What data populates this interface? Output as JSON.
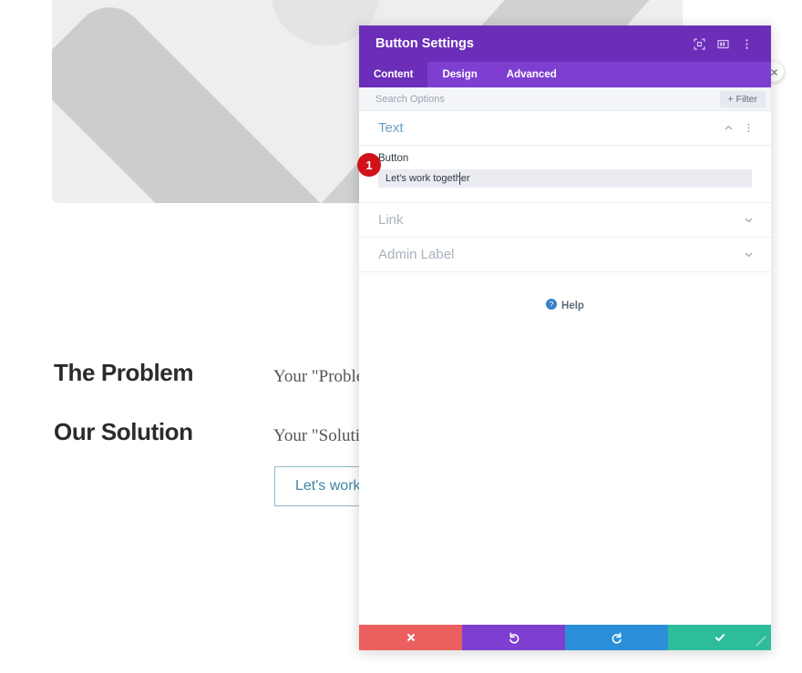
{
  "page": {
    "sections": [
      {
        "heading": "The Problem",
        "body": "Your \"Problem"
      },
      {
        "heading": "Our Solution",
        "body": "Your \"Solutio"
      }
    ],
    "cta_label": "Let's work tog",
    "hero_icon": "image-placeholder-icon"
  },
  "modal": {
    "title": "Button Settings",
    "header_icons": [
      {
        "name": "fullscreen-icon"
      },
      {
        "name": "layout-columns-icon"
      },
      {
        "name": "vertical-dots-icon"
      }
    ],
    "tabs": [
      {
        "label": "Content",
        "active": true
      },
      {
        "label": "Design",
        "active": false
      },
      {
        "label": "Advanced",
        "active": false
      }
    ],
    "search": {
      "placeholder": "Search Options",
      "value": ""
    },
    "filter_label": "+ Filter",
    "groups": [
      {
        "title": "Text",
        "expanded": true,
        "toggle_icon": "chevron-up-icon",
        "menu_icon": "vertical-dots-icon",
        "field_label": "Button",
        "field_value": "Let's work together"
      },
      {
        "title": "Link",
        "expanded": false,
        "toggle_icon": "chevron-down-icon"
      },
      {
        "title": "Admin Label",
        "expanded": false,
        "toggle_icon": "chevron-down-icon"
      }
    ],
    "help_label": "Help",
    "help_icon": "question-circle-icon",
    "footer_buttons": [
      {
        "name": "cancel-button",
        "icon": "close-x-icon",
        "color": "#ec5f5f"
      },
      {
        "name": "undo-button",
        "icon": "undo-icon",
        "color": "#7e3fd1"
      },
      {
        "name": "redo-button",
        "icon": "redo-icon",
        "color": "#2a8fd8"
      },
      {
        "name": "save-button",
        "icon": "checkmark-icon",
        "color": "#2ebd9a"
      }
    ],
    "resize_handle": "resize-grip-icon",
    "close_bubble_icon": "close-circle-icon"
  },
  "annotation": {
    "step_number": "1"
  },
  "colors": {
    "header_purple": "#6c2eb9",
    "tabbar_purple": "#7e3fd1",
    "badge_red": "#d1121b",
    "group_title_blue": "#6b9fc4",
    "cta_blue": "#3f87a6"
  }
}
